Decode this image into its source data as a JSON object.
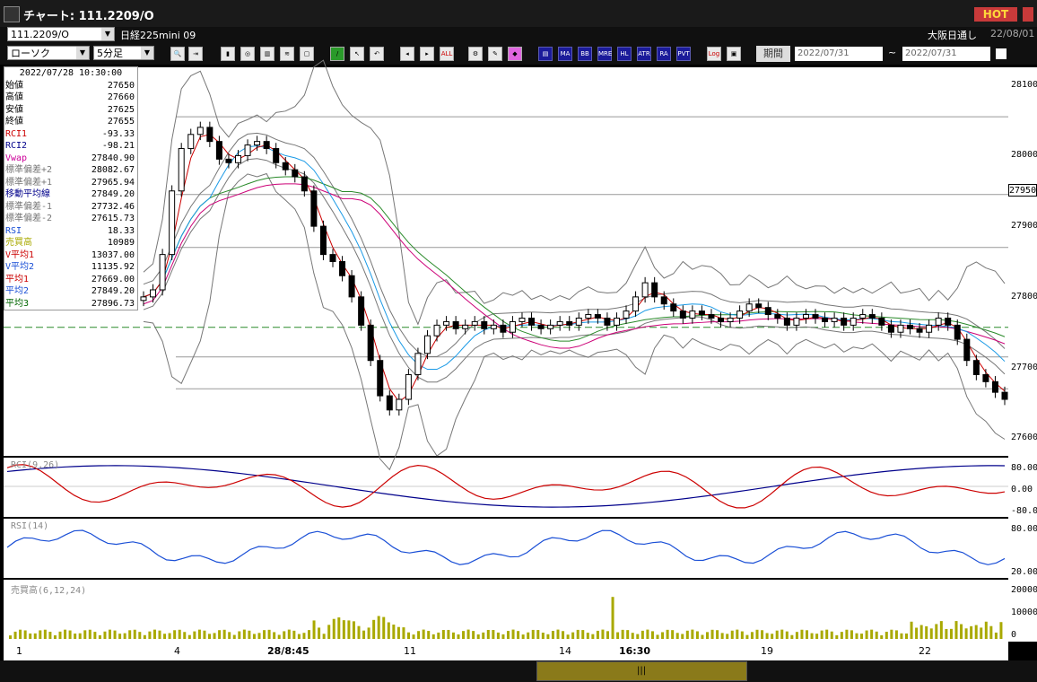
{
  "window": {
    "title": "チャート: 111.2209/O",
    "hot_label": "HOT"
  },
  "toolbar": {
    "symbol": "111.2209/O",
    "symbol_name": "日経225mini 09",
    "chart_type": "ローソク",
    "timeframe": "5分足",
    "session": "大阪日通し",
    "session_date": "22/08/01",
    "period_label": "期間",
    "date_from": "2022/07/31",
    "date_to": "2022/07/31",
    "range_sep": "~",
    "icons": [
      "zoom-icon",
      "fit-icon",
      "candle-icon",
      "rci-icon",
      "bar-icon",
      "ma-icon",
      "lock-icon",
      "draw-icon",
      "cursor-icon",
      "undo-icon",
      "period-left-icon",
      "period-right-icon",
      "all-icon",
      "settings-icon",
      "edit-icon",
      "color-icon",
      "tick-icon",
      "ma-btn",
      "bb-btn",
      "mre-btn",
      "hl-btn",
      "atr-btn",
      "ra-btn",
      "pvt-btn",
      "log-icon",
      "window-icon"
    ],
    "icon_labels": {
      "all": "ALL",
      "ma": "MA",
      "bb": "BB",
      "mre": "MRE",
      "hl": "HL",
      "atr": "ATR",
      "ra": "RA",
      "pvt": "PVT",
      "log": "Log"
    }
  },
  "data_window": {
    "timestamp": "2022/07/28  10:30:00",
    "rows": [
      {
        "k": "始値",
        "v": "27650",
        "c": "#000"
      },
      {
        "k": "高値",
        "v": "27660",
        "c": "#000"
      },
      {
        "k": "安値",
        "v": "27625",
        "c": "#000"
      },
      {
        "k": "終値",
        "v": "27655",
        "c": "#000"
      },
      {
        "k": "RCI1",
        "v": "-93.33",
        "c": "#cc0000"
      },
      {
        "k": "RCI2",
        "v": "-98.21",
        "c": "#00008b"
      },
      {
        "k": "Vwap",
        "v": "27840.90",
        "c": "#cc0099"
      },
      {
        "k": "標準偏差+2",
        "v": "28082.67",
        "c": "#777"
      },
      {
        "k": "標準偏差+1",
        "v": "27965.94",
        "c": "#777"
      },
      {
        "k": "移動平均線",
        "v": "27849.20",
        "c": "#00008b"
      },
      {
        "k": "標準偏差-1",
        "v": "27732.46",
        "c": "#777"
      },
      {
        "k": "標準偏差-2",
        "v": "27615.73",
        "c": "#777"
      },
      {
        "k": "RSI",
        "v": "18.33",
        "c": "#1a4fd6"
      },
      {
        "k": "売買高",
        "v": "10989",
        "c": "#a9a900"
      },
      {
        "k": "V平均1",
        "v": "13037.00",
        "c": "#cc0000"
      },
      {
        "k": "V平均2",
        "v": "11135.92",
        "c": "#1a4fd6"
      },
      {
        "k": "平均1",
        "v": "27669.00",
        "c": "#cc0000"
      },
      {
        "k": "平均2",
        "v": "27849.20",
        "c": "#1a4fd6"
      },
      {
        "k": "平均3",
        "v": "27896.73",
        "c": "#006600"
      }
    ]
  },
  "panels": {
    "rci_label": "RCI(9,26)",
    "rsi_label": "RSI(14)",
    "vol_label": "売買高(6,12,24)"
  },
  "chart_data": {
    "type": "candlestick",
    "price_axis": {
      "ticks": [
        28100,
        28000,
        27900,
        27800,
        27700,
        27600
      ],
      "current_price": "27950",
      "ylim": [
        27575,
        28125
      ]
    },
    "rci_axis": {
      "ticks": [
        "80.00",
        "0.00",
        "-80.00"
      ]
    },
    "rsi_axis": {
      "ticks": [
        "80.00",
        "20.00"
      ]
    },
    "vol_axis": {
      "ticks": [
        "20000",
        "10000",
        "0"
      ]
    },
    "x_labels": [
      "1",
      "4",
      "28/8:45",
      "11",
      "14",
      "16:30",
      "19",
      "22"
    ],
    "close_path": [
      27800,
      27810,
      27860,
      27950,
      28010,
      28030,
      28040,
      28020,
      27995,
      27990,
      28000,
      28015,
      28020,
      28010,
      27990,
      27980,
      27970,
      27950,
      27900,
      27860,
      27850,
      27830,
      27800,
      27760,
      27710,
      27660,
      27640,
      27655,
      27690,
      27720,
      27745,
      27760,
      27765,
      27755,
      27760,
      27765,
      27755,
      27760,
      27750,
      27765,
      27770,
      27760,
      27755,
      27760,
      27765,
      27760,
      27770,
      27775,
      27770,
      27760,
      27770,
      27780,
      27800,
      27820,
      27800,
      27790,
      27780,
      27770,
      27780,
      27775,
      27770,
      27765,
      27770,
      27780,
      27790,
      27785,
      27775,
      27770,
      27760,
      27770,
      27775,
      27770,
      27765,
      27770,
      27760,
      27770,
      27775,
      27770,
      27760,
      27750,
      27760,
      27755,
      27750,
      27760,
      27770,
      27760,
      27740,
      27710,
      27690,
      27680,
      27665,
      27655
    ]
  },
  "colors": {
    "up": "#000",
    "down": "#000",
    "ma1": "#cc0000",
    "ma2": "#1a9ae6",
    "ma3": "#2a8a2a",
    "vwap": "#cc0077",
    "bb": "#777",
    "rci1": "#cc0000",
    "rci2": "#00008b",
    "rsi": "#1a4fd6",
    "vol": "#a9a900"
  }
}
